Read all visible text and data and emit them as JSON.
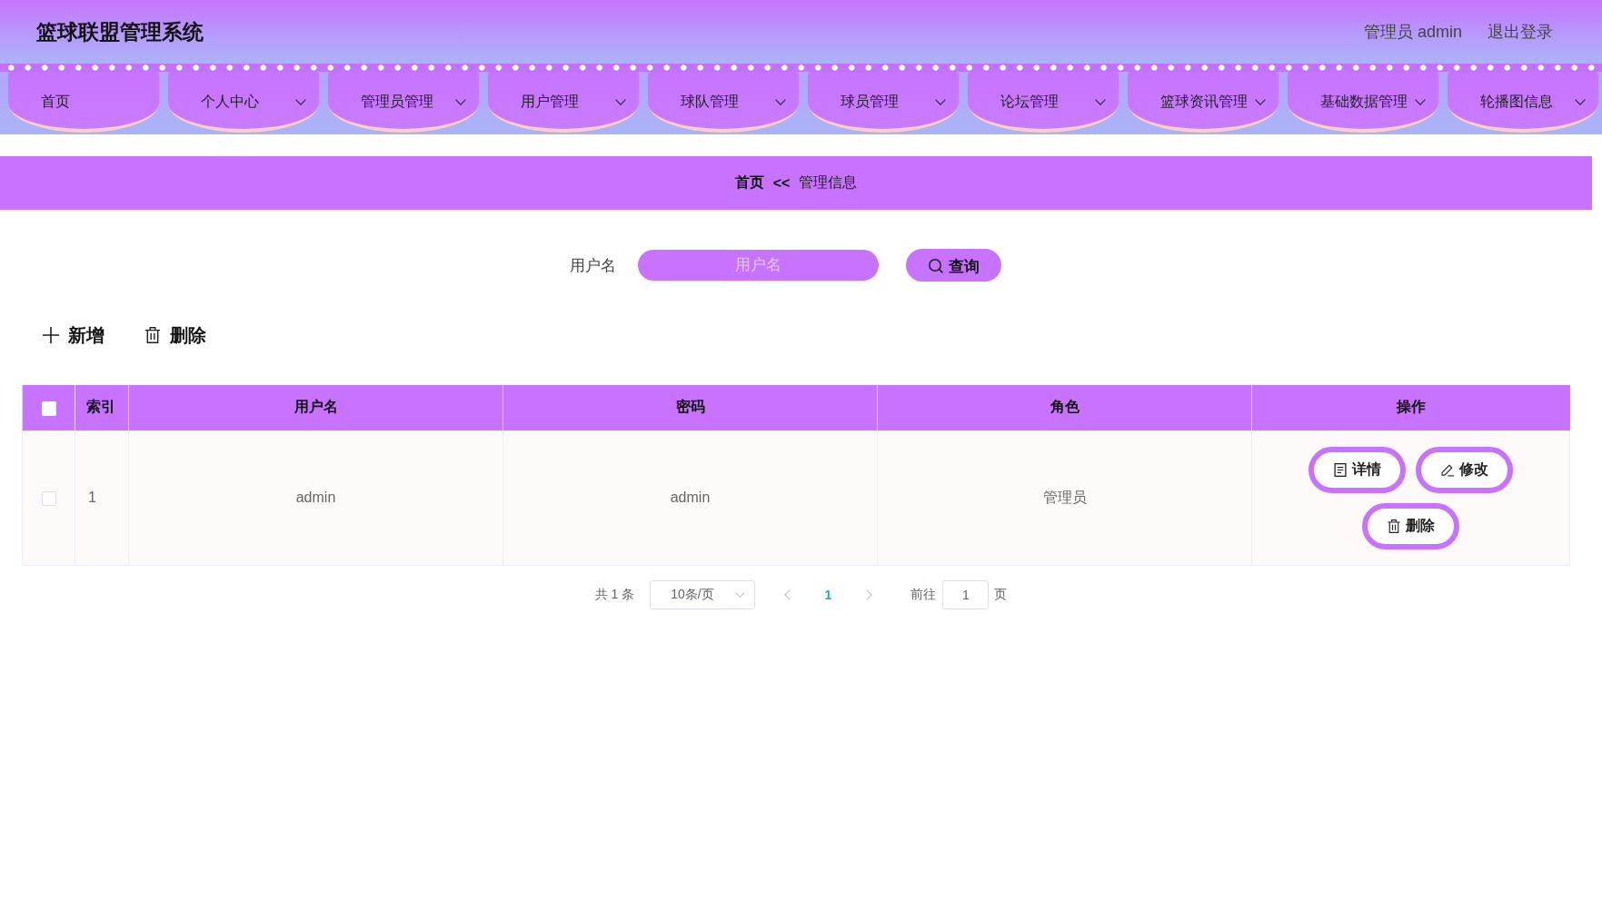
{
  "header": {
    "title": "篮球联盟管理系统",
    "user": "管理员 admin",
    "logout": "退出登录"
  },
  "nav": [
    {
      "label": "首页",
      "has_dropdown": false
    },
    {
      "label": "个人中心",
      "has_dropdown": true
    },
    {
      "label": "管理员管理",
      "has_dropdown": true
    },
    {
      "label": "用户管理",
      "has_dropdown": true
    },
    {
      "label": "球队管理",
      "has_dropdown": true
    },
    {
      "label": "球员管理",
      "has_dropdown": true
    },
    {
      "label": "论坛管理",
      "has_dropdown": true
    },
    {
      "label": "篮球资讯管理",
      "has_dropdown": true
    },
    {
      "label": "基础数据管理",
      "has_dropdown": true
    },
    {
      "label": "轮播图信息",
      "has_dropdown": true
    }
  ],
  "breadcrumb": {
    "home": "首页",
    "separator": "<<",
    "current": "管理信息"
  },
  "search": {
    "label": "用户名",
    "placeholder": "用户名",
    "button": "查询"
  },
  "toolbar": [
    {
      "kind": "add",
      "label": "新增"
    },
    {
      "kind": "delete",
      "label": "删除"
    }
  ],
  "table": {
    "select_all": {
      "checked": false
    },
    "columns": [
      "索引",
      "用户名",
      "密码",
      "角色",
      "操作"
    ],
    "rows": [
      {
        "checked": false,
        "cells": [
          "1",
          "admin",
          "admin",
          "管理员"
        ],
        "actions": [
          {
            "kind": "detail",
            "label": "详情"
          },
          {
            "kind": "edit",
            "label": "修改"
          },
          {
            "kind": "delete",
            "label": "删除"
          }
        ]
      }
    ]
  },
  "pagination": {
    "total": "共 1 条",
    "page_size": "10条/页",
    "prev_button": {
      "disabled": true
    },
    "pages": [
      {
        "label": "1",
        "selected": true
      }
    ],
    "next_button": {
      "disabled": true
    },
    "goto_label": "前往",
    "goto_value": "1",
    "page_unit": "页"
  }
}
